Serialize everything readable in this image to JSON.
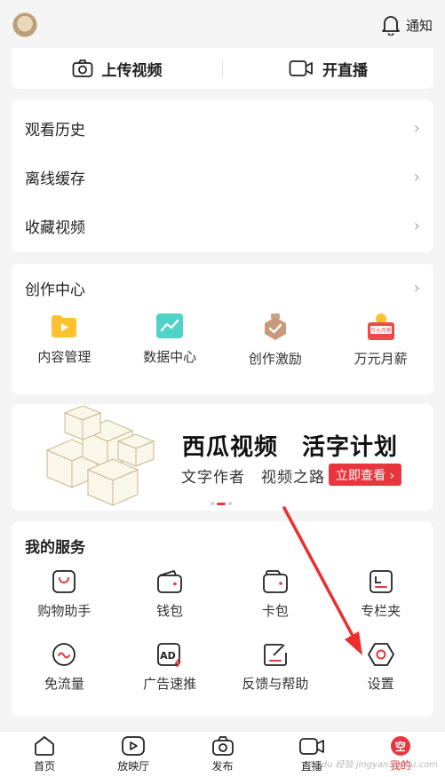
{
  "top": {
    "notify_label": "通知"
  },
  "upload": {
    "upload_label": "上传视频",
    "live_label": "开直播"
  },
  "history": {
    "items": [
      {
        "label": "观看历史"
      },
      {
        "label": "离线缓存"
      },
      {
        "label": "收藏视频"
      }
    ]
  },
  "create": {
    "title": "创作中心",
    "items": [
      {
        "label": "内容管理"
      },
      {
        "label": "数据中心"
      },
      {
        "label": "创作激励"
      },
      {
        "label": "万元月薪"
      }
    ],
    "salary_icon_text": "万元月薪"
  },
  "banner": {
    "title": "西瓜视频　活字计划",
    "subtitle": "文字作者　视频之路",
    "button": "立即查看 ›"
  },
  "services": {
    "title": "我的服务",
    "items": [
      {
        "label": "购物助手"
      },
      {
        "label": "钱包"
      },
      {
        "label": "卡包"
      },
      {
        "label": "专栏夹"
      },
      {
        "label": "免流量"
      },
      {
        "label": "广告速推"
      },
      {
        "label": "反馈与帮助"
      },
      {
        "label": "设置"
      }
    ],
    "ad_icon_text": "AD"
  },
  "tabs": [
    {
      "label": "首页"
    },
    {
      "label": "放映厅"
    },
    {
      "label": "发布"
    },
    {
      "label": "直播"
    },
    {
      "label": "我的"
    }
  ],
  "me_badge_text": "空",
  "watermark": "Baidu 经验 jingyan.baidu.com",
  "colors": {
    "accent": "#e8363f",
    "background": "#f4f4f4"
  }
}
